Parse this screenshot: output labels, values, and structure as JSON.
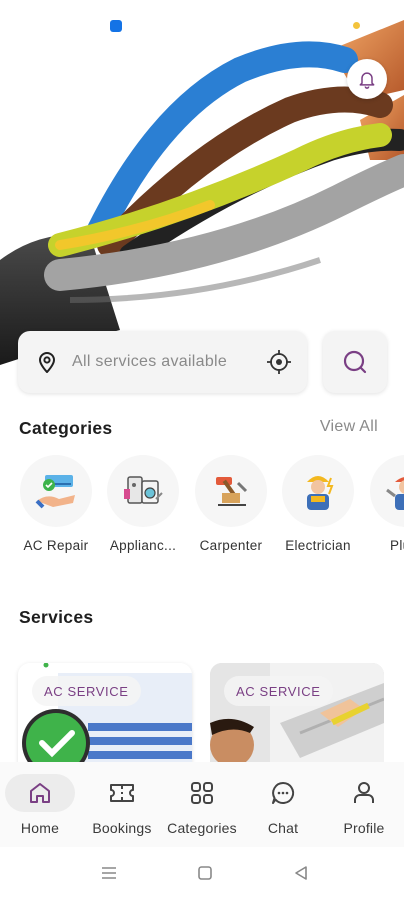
{
  "status_bar": {
    "app_icon": "cloud-icon",
    "indicator_color": "#f3c33c"
  },
  "hero": {
    "image": "electrical-cable-wires",
    "notification_icon": "bell-icon"
  },
  "search": {
    "placeholder": "All services available",
    "location_icon": "map-pin-icon",
    "gps_icon": "crosshair-icon",
    "search_icon": "search-icon"
  },
  "categories": {
    "title": "Categories",
    "view_all": "View All",
    "items": [
      {
        "label": "AC Repair",
        "icon": "ac-repair-icon"
      },
      {
        "label": "Applianc...",
        "icon": "appliance-icon"
      },
      {
        "label": "Carpenter",
        "icon": "carpenter-icon"
      },
      {
        "label": "Electrician",
        "icon": "electrician-icon"
      },
      {
        "label": "Plum",
        "icon": "plumber-icon"
      }
    ]
  },
  "services": {
    "title": "Services",
    "items": [
      {
        "badge": "AC SERVICE"
      },
      {
        "badge": "AC SERVICE"
      }
    ]
  },
  "bottom_nav": {
    "items": [
      {
        "label": "Home",
        "icon": "home-icon",
        "active": true
      },
      {
        "label": "Bookings",
        "icon": "ticket-icon"
      },
      {
        "label": "Categories",
        "icon": "grid-icon"
      },
      {
        "label": "Chat",
        "icon": "chat-icon"
      },
      {
        "label": "Profile",
        "icon": "user-icon"
      }
    ]
  },
  "system_nav": {
    "items": [
      "menu-icon",
      "home-square-icon",
      "back-triangle-icon"
    ]
  },
  "colors": {
    "accent": "#7a3f84",
    "background": "#ffffff",
    "card": "#f4f4f4"
  }
}
